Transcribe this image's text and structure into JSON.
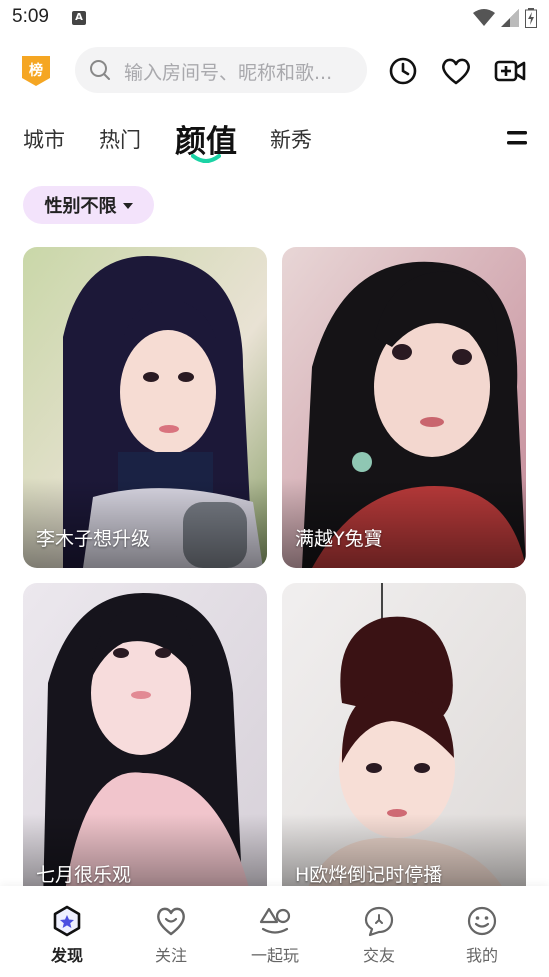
{
  "status_bar": {
    "time": "5:09",
    "a_badge": "A"
  },
  "header": {
    "rank_badge": "榜",
    "search_placeholder": "输入房间号、昵称和歌...",
    "icons": [
      "history-clock-icon",
      "heart-icon",
      "video-camera-add-icon"
    ]
  },
  "tabs": [
    {
      "label": "城市",
      "active": false
    },
    {
      "label": "热门",
      "active": false
    },
    {
      "label": "颜值",
      "active": true
    },
    {
      "label": "新秀",
      "active": false
    }
  ],
  "filter": {
    "label": "性别不限"
  },
  "cards": [
    {
      "name": "李木子想升级"
    },
    {
      "name": "满越Y兔寶"
    },
    {
      "name": "七月很乐观"
    },
    {
      "name": "H欧烨倒记时停播"
    }
  ],
  "bottom_nav": [
    {
      "label": "发现",
      "icon": "discover-star-icon",
      "active": true
    },
    {
      "label": "关注",
      "icon": "follow-heart-icon",
      "active": false
    },
    {
      "label": "一起玩",
      "icon": "play-together-icon",
      "active": false
    },
    {
      "label": "交友",
      "icon": "chat-bubble-icon",
      "active": false
    },
    {
      "label": "我的",
      "icon": "profile-smile-icon",
      "active": false
    }
  ],
  "colors": {
    "accent": "#1bd3a5",
    "chip_bg": "#f3e3fb",
    "rank_orange": "#f5a623"
  }
}
